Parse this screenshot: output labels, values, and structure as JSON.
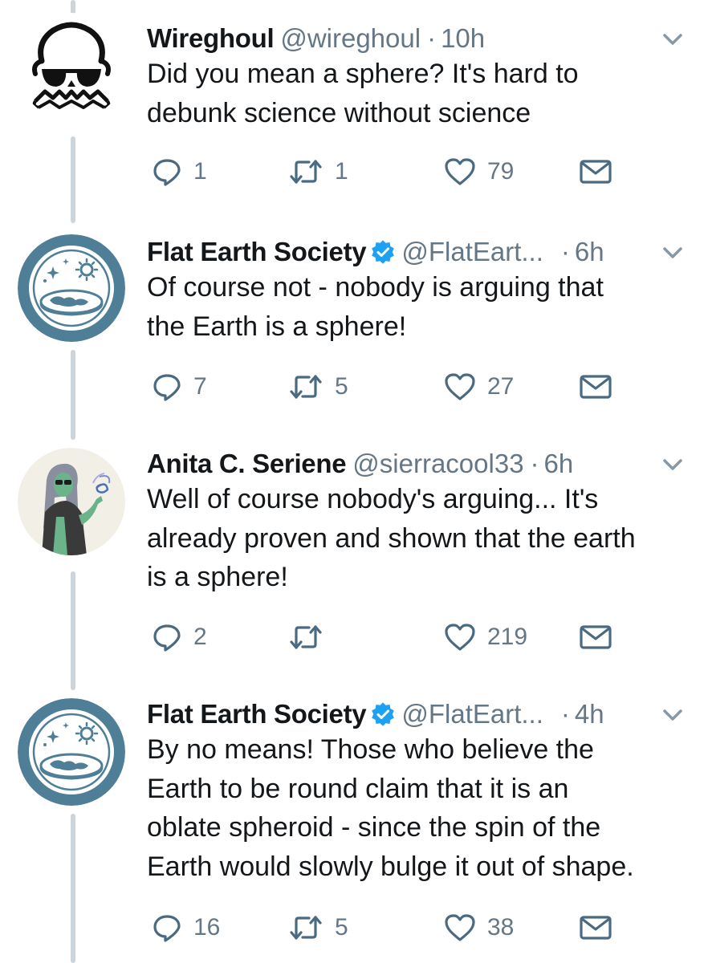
{
  "tweets": [
    {
      "name": "Wireghoul",
      "handle": "@wireghoul",
      "separator": "·",
      "time": "10h",
      "verified": false,
      "text": "Did you mean a sphere? It's hard to\ndebunk science without science",
      "replies": "1",
      "retweets": "1",
      "likes": "79",
      "avatar_icon": "skull-icon"
    },
    {
      "name": "Flat Earth Society",
      "handle": "@FlatEart...",
      "separator": "·",
      "time": "6h",
      "verified": true,
      "text": "Of course not - nobody is arguing that\nthe Earth is a sphere!",
      "replies": "7",
      "retweets": "5",
      "likes": "27",
      "avatar_icon": "flat-earth-logo-icon"
    },
    {
      "name": "Anita C. Seriene",
      "handle": "@sierracool33",
      "separator": "·",
      "time": "6h",
      "verified": false,
      "text": "Well of course nobody's arguing... It's\nalready proven and shown that the earth\nis a sphere!",
      "replies": "2",
      "retweets": "",
      "likes": "219",
      "avatar_icon": "drawing-avatar-icon"
    },
    {
      "name": "Flat Earth Society",
      "handle": "@FlatEart...",
      "separator": "·",
      "time": "4h",
      "verified": true,
      "text": "By no means! Those who believe the\nEarth to be round claim that it is an\noblate spheroid - since the spin of the\nEarth would slowly bulge it out of shape.",
      "replies": "16",
      "retweets": "5",
      "likes": "38",
      "avatar_icon": "flat-earth-logo-icon"
    }
  ],
  "colors": {
    "text": "#14171a",
    "secondary": "#657786",
    "icon": "#4a6a82",
    "verified": "#1da1f2",
    "thread_line": "#cdd4da",
    "logo_ring": "#4f7f96"
  }
}
